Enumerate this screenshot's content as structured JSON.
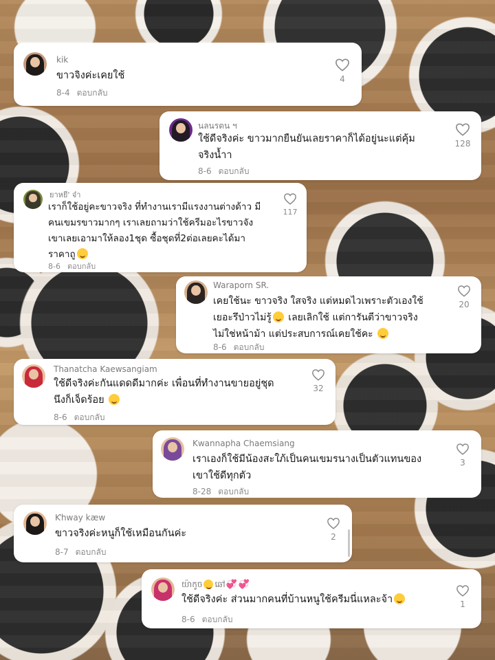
{
  "comments": [
    {
      "username": "kik",
      "text": "ขาวจิงค่ะเคยใช้",
      "date": "8-4",
      "reply": "ตอบกลับ",
      "likes": "4",
      "avatar_colors": [
        "#1d1d1d",
        "#c69a7e"
      ]
    },
    {
      "username": "นลนรตน ฯ",
      "text": "ใช้ดีจริงค่ะ ขาวมากยืนยันเลยราคาก็ได้อยู่นะแต่คุ้มจริงน้ำา",
      "date": "8-6",
      "reply": "ตอบกลับ",
      "likes": "128",
      "avatar_colors": [
        "#6a2b8a",
        "#e7c3a6"
      ]
    },
    {
      "username": "ยาหยี' จ๋า",
      "text": "เราก็ใช้อยู่คะขาวจริง ที่ทำงานเรามีแรงงานต่างด้าว มีคนเขมรขาวมากๆ เราเลยถามว่าใช้ครีมอะไรขาวจังเขาเลยเอามาให้ลอง1ชุด ซื้อชุดที่2ต่อเลยคะได้มาราคาถู",
      "date": "8-6",
      "reply": "ตอบกลับ",
      "likes": "117",
      "avatar_colors": [
        "#7c8a3c",
        "#3a3a2a"
      ]
    },
    {
      "username": "Waraporn SR.",
      "text": "เคยใช้นะ ขาวจริง ใสจริง แต่หมดไวเพราะตัวเองใช้เยอะรึป่าวไม่รู้ เลยเลิกใช้ แต่การันตีว่าขาวจริงไม่ใช่หน้าม้า แต่ประสบการณ์เคยใช้คะ",
      "date": "8-6",
      "reply": "ตอบกลับ",
      "likes": "20",
      "avatar_colors": [
        "#2a2422",
        "#d9b08e"
      ]
    },
    {
      "username": "Thanatcha Kaewsangiam",
      "text": "ใช้ดีจริงค่ะกันแดดดีมากค่ะ เพื่อนที่ทำงานขายอยู่ชุดนึงก็เจ็ดร้อย",
      "date": "8-6",
      "reply": "ตอบกลับ",
      "likes": "32",
      "avatar_colors": [
        "#c92a3a",
        "#e8c0a0"
      ]
    },
    {
      "username": "Kwannapha Chaemsiang",
      "text": "เราเองก็ใช้มีน้องสะใภ้เป็นคนเขมรนางเป็นตัวแทนของเขาใช้ดีทุกตัว",
      "date": "8-28",
      "reply": "ตอบกลับ",
      "likes": "3",
      "avatar_colors": [
        "#7a4a9a",
        "#e6bfa2"
      ]
    },
    {
      "username": "Ƙhway kæw",
      "text": "ขาวจริงค่ะหนูก็ใช้เหมือนกันค่ะ",
      "date": "8-7",
      "reply": "ตอบกลับ",
      "likes": "2",
      "avatar_colors": [
        "#1c1818",
        "#e2b896"
      ]
    },
    {
      "username": "យ៉ាកូចឆៅ",
      "text": "ใช้ดีจริงค่ะ ส่วนมากคนที่บ้านหนูใช้ครีมนี่แหละจ้า",
      "date": "8-6",
      "reply": "ตอบกลับ",
      "likes": "1",
      "avatar_colors": [
        "#c8326a",
        "#e4b89a"
      ]
    }
  ],
  "lines": {
    "c1": [
      "ใช้ดีจริงค่ะ ขาวมากยืนยันเลยราคาก็ได้อยู่นะแต่คุ้ม",
      "จริงน้ำา"
    ],
    "c2": [
      "เราก็ใช้อยู่คะขาวจริง ที่ทำงานเรามีแรงงานต่างด้าว มี",
      "คนเขมรขาวมากๆ เราเลยถามว่าใช้ครีมอะไรขาวจัง",
      "เขาเลยเอามาให้ลอง1ชุด ซื้อชุดที่2ต่อเลยคะได้มา",
      "ราคาถู"
    ],
    "c3": [
      "เคยใช้นะ ขาวจริง ใสจริง แต่หมดไวเพราะตัวเองใช้",
      "เยอะรึป่าวไม่รู้",
      " เลยเลิกใช้ แต่การันตีว่าขาวจริง",
      "ไม่ใช่หน้าม้า แต่ประสบการณ์เคยใช้คะ"
    ],
    "c4": [
      "ใช้ดีจริงค่ะกันแดดดีมากค่ะ เพื่อนที่ทำงานขายอยู่ชุด",
      "นึงก็เจ็ดร้อย"
    ],
    "c5": [
      "เราเองก็ใช้มีน้องสะใภ้เป็นคนเขมรนางเป็นตัวแทนของ",
      "เขาใช้ดีทุกตัว"
    ],
    "c7a": "យ៉ាកូច",
    "c7b": "ឆៅ"
  },
  "colors": {
    "card": "#ffffff",
    "text": "#161616",
    "muted": "#8a8a8a"
  }
}
